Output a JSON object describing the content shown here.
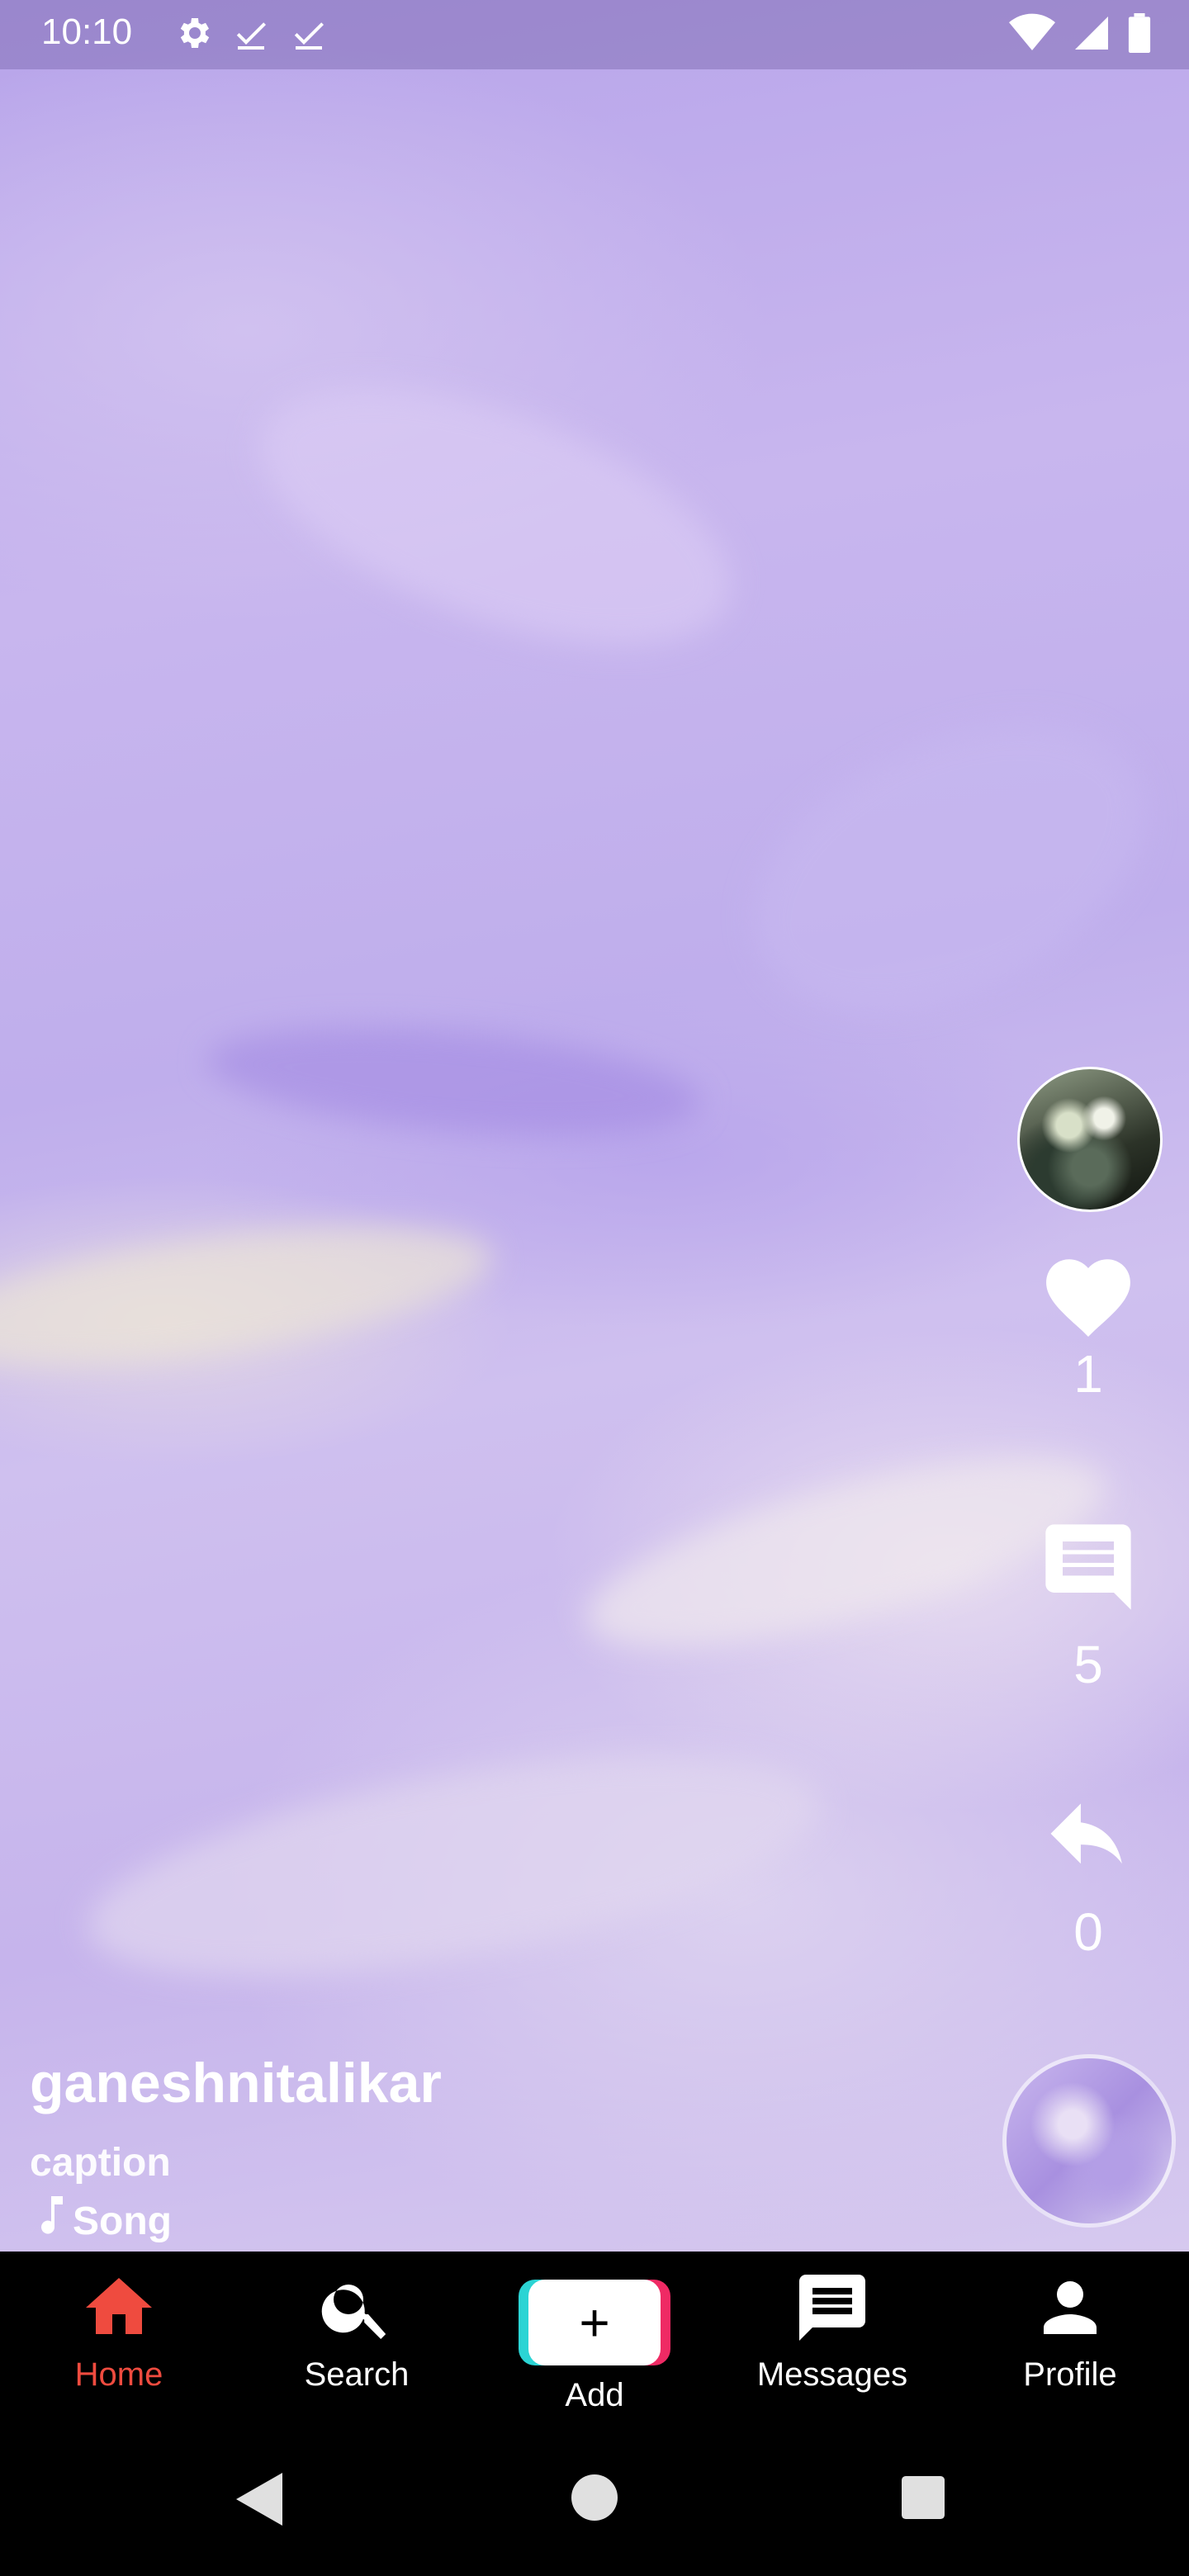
{
  "status_bar": {
    "time": "10:10",
    "icons": [
      "gear-icon",
      "check-icon",
      "check-icon",
      "wifi-icon",
      "signal-icon",
      "battery-icon"
    ]
  },
  "post": {
    "username": "ganeshnitalikar",
    "caption": "caption",
    "song": "Song",
    "likes": "1",
    "comments": "5",
    "shares": "0"
  },
  "bottom_nav": {
    "items": [
      {
        "label": "Home",
        "icon": "home-icon",
        "active": true
      },
      {
        "label": "Search",
        "icon": "search-icon"
      },
      {
        "label": "Add",
        "icon": "add-icon"
      },
      {
        "label": "Messages",
        "icon": "message-icon"
      },
      {
        "label": "Profile",
        "icon": "person-icon"
      }
    ]
  },
  "colors": {
    "active": "#ef4b3f",
    "add_left": "#2bd4d4",
    "add_right": "#ef2a64"
  }
}
